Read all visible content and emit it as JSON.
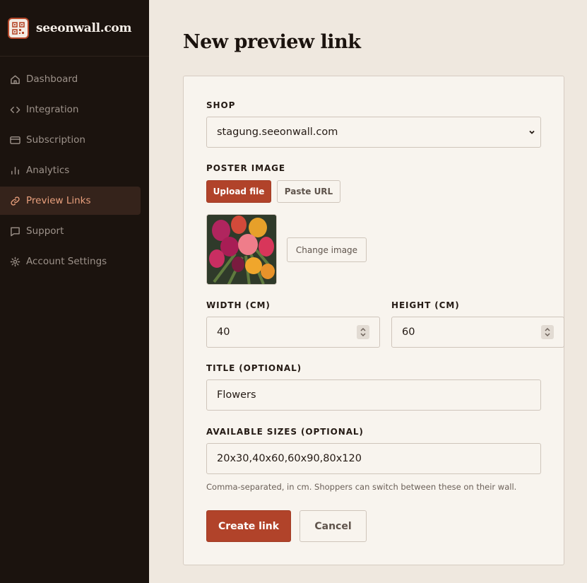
{
  "brand": {
    "name": "seeonwall.com",
    "logo_icon": "qr-code-icon"
  },
  "sidebar": {
    "items": [
      {
        "label": "Dashboard",
        "icon": "home-icon",
        "active": false
      },
      {
        "label": "Integration",
        "icon": "code-icon",
        "active": false
      },
      {
        "label": "Subscription",
        "icon": "credit-card-icon",
        "active": false
      },
      {
        "label": "Analytics",
        "icon": "bar-chart-icon",
        "active": false
      },
      {
        "label": "Preview Links",
        "icon": "link-icon",
        "active": true
      },
      {
        "label": "Support",
        "icon": "chat-icon",
        "active": false
      },
      {
        "label": "Account Settings",
        "icon": "gear-icon",
        "active": false
      }
    ]
  },
  "page": {
    "title": "New preview link"
  },
  "form": {
    "shop": {
      "label": "SHOP",
      "value": "stagung.seeonwall.com"
    },
    "poster": {
      "label": "POSTER IMAGE",
      "upload_label": "Upload file",
      "paste_label": "Paste URL",
      "change_label": "Change image"
    },
    "width": {
      "label": "WIDTH (CM)",
      "value": "40"
    },
    "height": {
      "label": "HEIGHT (CM)",
      "value": "60"
    },
    "title": {
      "label": "TITLE (OPTIONAL)",
      "value": "Flowers"
    },
    "sizes": {
      "label": "AVAILABLE SIZES (OPTIONAL)",
      "value": "20x30,40x60,60x90,80x120",
      "hint": "Comma-separated, in cm. Shoppers can switch between these on their wall."
    },
    "create_label": "Create link",
    "cancel_label": "Cancel"
  },
  "colors": {
    "accent": "#b1432a",
    "sidebar_bg": "#1b130e",
    "page_bg": "#efe8df",
    "card_bg": "#f8f4ee"
  }
}
